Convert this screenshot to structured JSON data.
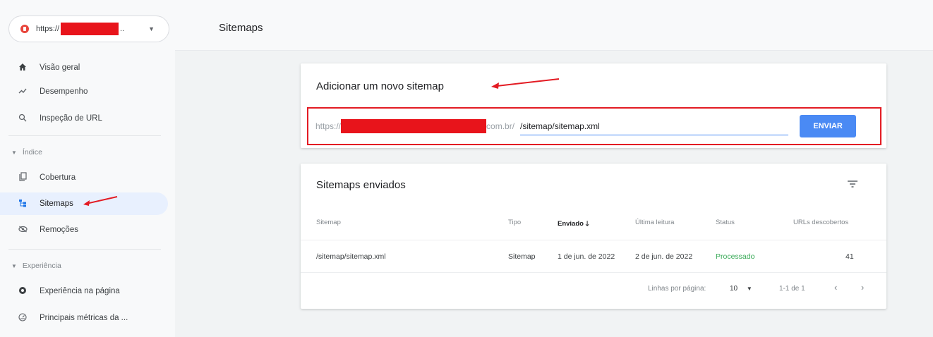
{
  "property": {
    "prefix": "https://",
    "ellipsis": "..",
    "caret": "▼"
  },
  "sidebar": {
    "items_top": [
      {
        "label": "Visão geral",
        "icon": "home-icon"
      },
      {
        "label": "Desempenho",
        "icon": "trending-up-icon"
      },
      {
        "label": "Inspeção de URL",
        "icon": "search-icon"
      }
    ],
    "section_index": "Índice",
    "items_index": [
      {
        "label": "Cobertura",
        "icon": "copy-icon"
      },
      {
        "label": "Sitemaps",
        "icon": "sitemap-icon"
      },
      {
        "label": "Remoções",
        "icon": "eye-off-icon"
      }
    ],
    "section_experience": "Experiência",
    "items_experience": [
      {
        "label": "Experiência na página",
        "icon": "page-experience-icon"
      },
      {
        "label": "Principais métricas da ...",
        "icon": "gauge-icon"
      }
    ]
  },
  "header": {
    "title": "Sitemaps"
  },
  "add_card": {
    "title": "Adicionar um novo sitemap",
    "prefix_start": "https://",
    "prefix_end": "com.br/",
    "input_value": "/sitemap/sitemap.xml",
    "submit_label": "ENVIAR"
  },
  "list_card": {
    "title": "Sitemaps enviados",
    "columns": [
      "Sitemap",
      "Tipo",
      "Enviado",
      "Última leitura",
      "Status",
      "URLs descobertos"
    ],
    "sort_arrow": "🡓",
    "rows": [
      {
        "sitemap": "/sitemap/sitemap.xml",
        "tipo": "Sitemap",
        "enviado": "1 de jun. de 2022",
        "ultima": "2 de jun. de 2022",
        "status": "Processado",
        "urls": "41"
      }
    ],
    "pager": {
      "rows_label": "Linhas por página:",
      "rows_value": "10",
      "range": "1-1 de 1"
    }
  },
  "colors": {
    "accent": "#1a73e8",
    "status_ok": "#34a853",
    "annotation": "#e31b23",
    "button": "#4a8af4"
  }
}
